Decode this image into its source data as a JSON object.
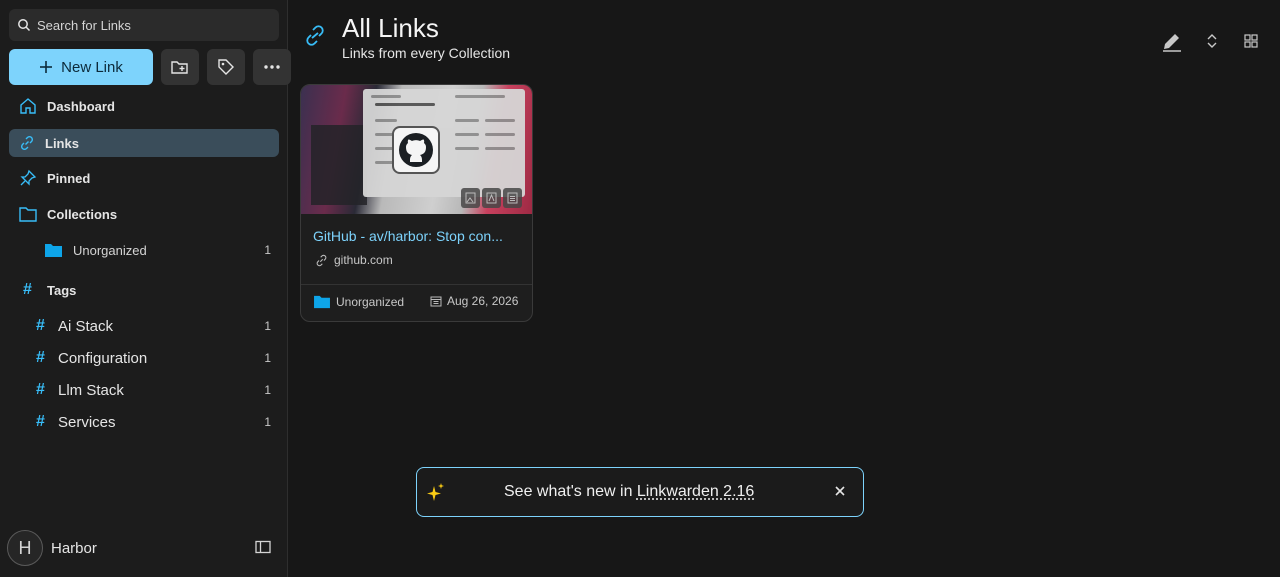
{
  "sidebar": {
    "search_placeholder": "Search for Links",
    "new_link_label": "New Link",
    "nav": {
      "dashboard": "Dashboard",
      "links": "Links",
      "pinned": "Pinned",
      "collections": "Collections",
      "tags": "Tags"
    },
    "collections": [
      {
        "name": "Unorganized",
        "count": "1",
        "color": "#0ea5e9"
      }
    ],
    "tags": [
      {
        "name": "Ai Stack",
        "count": "1"
      },
      {
        "name": "Configuration",
        "count": "1"
      },
      {
        "name": "Llm Stack",
        "count": "1"
      },
      {
        "name": "Services",
        "count": "1"
      }
    ],
    "user": {
      "initial": "H",
      "name": "Harbor"
    }
  },
  "header": {
    "title": "All Links",
    "subtitle": "Links from every Collection"
  },
  "cards": [
    {
      "title": "GitHub - av/harbor: Stop con...",
      "domain": "github.com",
      "collection": "Unorganized",
      "date": "Aug 26, 2026"
    }
  ],
  "toast": {
    "prefix": "See what's new in ",
    "link": "Linkwarden 2.16"
  },
  "colors": {
    "accent": "#7dd3fc",
    "tag_hash": "#38bdf8",
    "active_nav": "#3a4d5a"
  }
}
